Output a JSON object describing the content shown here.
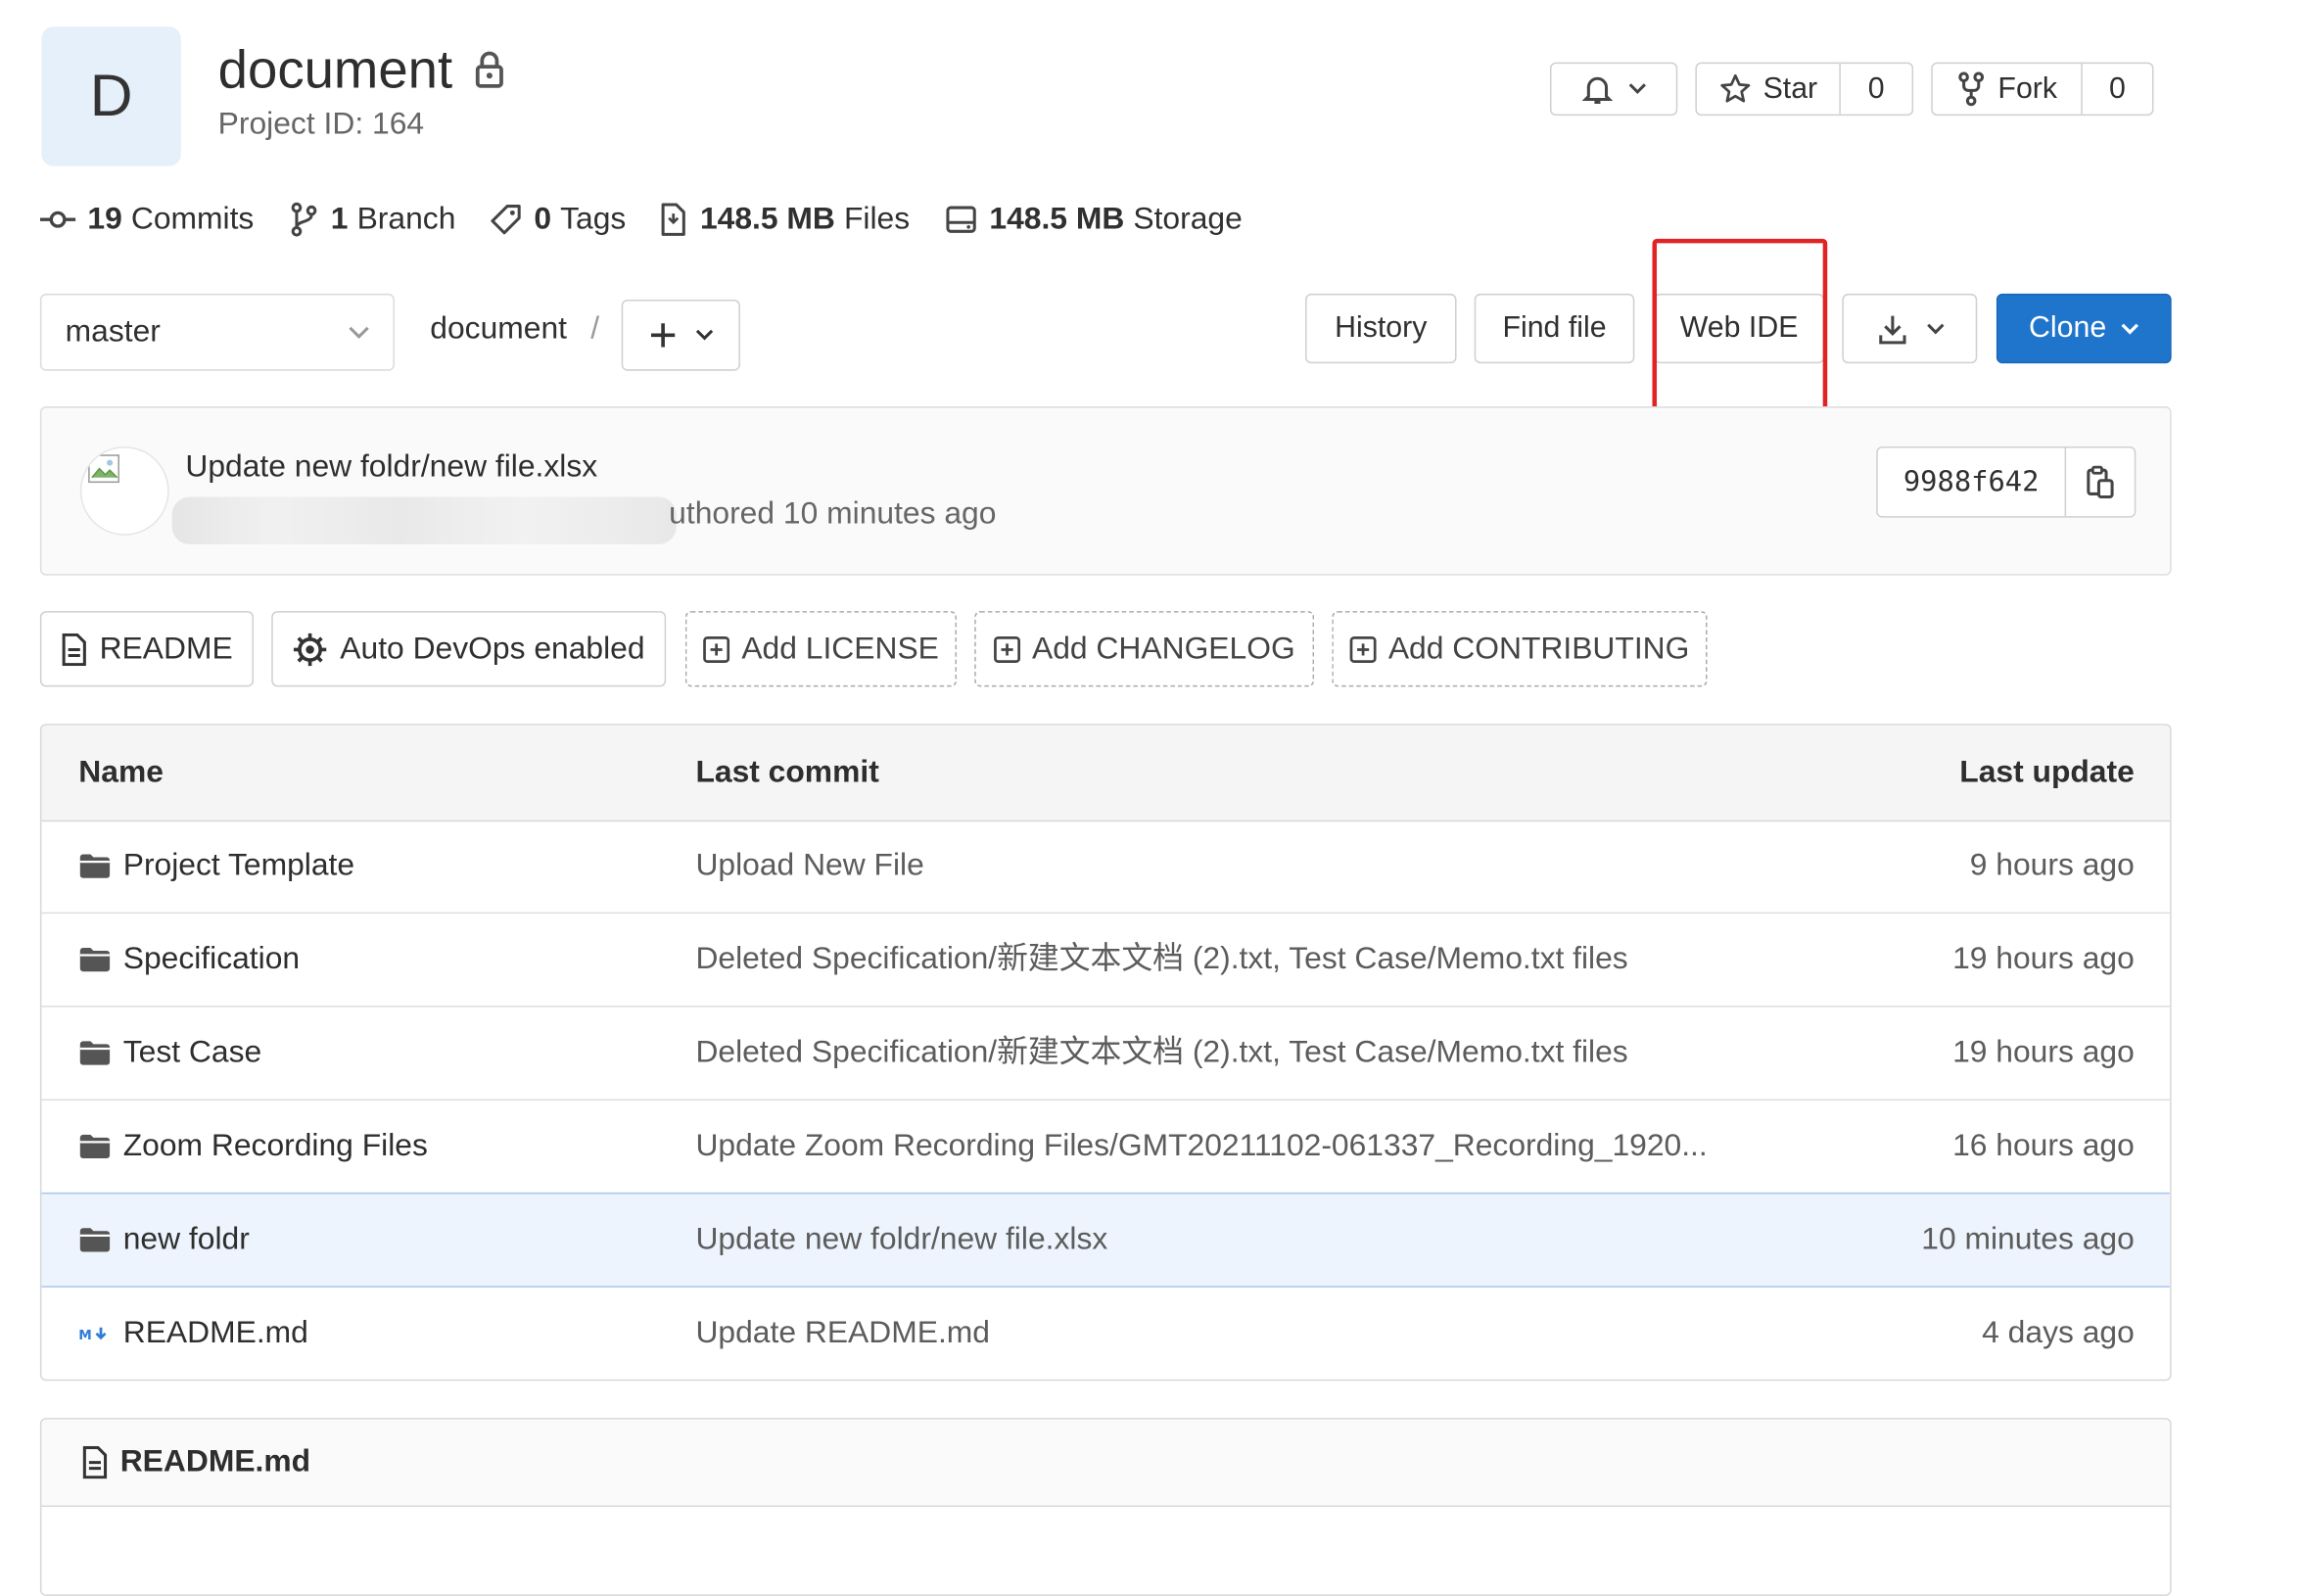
{
  "project": {
    "avatar_letter": "D",
    "title": "document",
    "project_id": "Project ID: 164"
  },
  "header_actions": {
    "star_label": "Star",
    "star_count": "0",
    "fork_label": "Fork",
    "fork_count": "0"
  },
  "stats": [
    {
      "value": "19",
      "label": "Commits"
    },
    {
      "value": "1",
      "label": "Branch"
    },
    {
      "value": "0",
      "label": "Tags"
    },
    {
      "value": "148.5 MB",
      "label": "Files"
    },
    {
      "value": "148.5 MB",
      "label": "Storage"
    }
  ],
  "toolbar": {
    "branch": "master",
    "path_root": "document",
    "path_sep": "/",
    "history": "History",
    "find_file": "Find file",
    "web_ide": "Web IDE",
    "clone": "Clone"
  },
  "last_commit": {
    "title": "Update new foldr/new file.xlsx",
    "authored": "uthored 10 minutes ago",
    "sha": "9988f642"
  },
  "badges": {
    "readme": "README",
    "autodevops": "Auto DevOps enabled",
    "add_license": "Add LICENSE",
    "add_changelog": "Add CHANGELOG",
    "add_contributing": "Add CONTRIBUTING"
  },
  "table": {
    "headers": {
      "name": "Name",
      "last_commit": "Last commit",
      "last_update": "Last update"
    },
    "rows": [
      {
        "name": "Project Template",
        "commit": "Upload New File",
        "updated": "9 hours ago",
        "type": "folder"
      },
      {
        "name": "Specification",
        "commit": "Deleted Specification/新建文本文档 (2).txt, Test Case/Memo.txt files",
        "updated": "19 hours ago",
        "type": "folder"
      },
      {
        "name": "Test Case",
        "commit": "Deleted Specification/新建文本文档 (2).txt, Test Case/Memo.txt files",
        "updated": "19 hours ago",
        "type": "folder"
      },
      {
        "name": "Zoom Recording Files",
        "commit": "Update Zoom Recording Files/GMT20211102-061337_Recording_1920...",
        "updated": "16 hours ago",
        "type": "folder"
      },
      {
        "name": "new foldr",
        "commit": "Update new foldr/new file.xlsx",
        "updated": "10 minutes ago",
        "type": "folder"
      },
      {
        "name": "README.md",
        "commit": "Update README.md",
        "updated": "4 days ago",
        "type": "markdown"
      }
    ]
  },
  "readme_panel": {
    "title": "README.md"
  },
  "colors": {
    "primary": "#1f75cb",
    "highlight_box": "#e02424",
    "row_highlight": "#eef4fd"
  }
}
